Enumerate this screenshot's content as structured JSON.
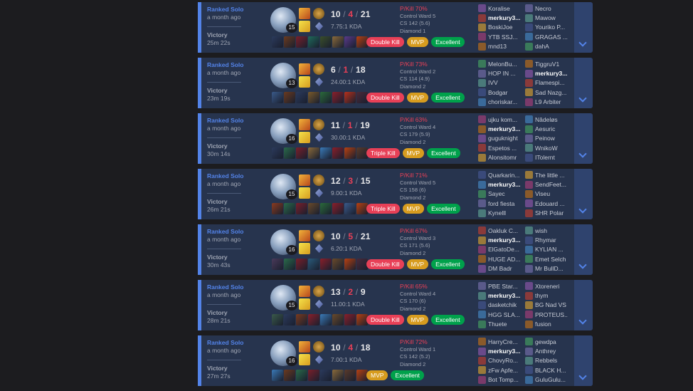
{
  "colors": {
    "win_accent": "#5383e8",
    "kill_red": "#e84057",
    "mvp": "#d79c1f",
    "excellent": "#00a14b"
  },
  "matches": [
    {
      "queue": "Ranked Solo",
      "ago": "a month ago",
      "result": "Victory",
      "duration": "25m 22s",
      "level": "15",
      "kills": "10",
      "deaths": "4",
      "assists": "21",
      "kda_ratio": "7.75:1 KDA",
      "badges": [
        "Double Kill",
        "MVP",
        "Excellent"
      ],
      "pkill": "P/Kill 70%",
      "control_ward": "Control Ward 5",
      "cs": "CS 142 (5.6)",
      "rank": "Diamond 1",
      "team1": [
        "Koralise",
        "merkury3...",
        "BoskiJoe",
        "YTB SSJ...",
        "mnd13"
      ],
      "team2": [
        "Necro",
        "Mawow",
        "Youriko P...",
        "GRAGAS ...",
        "dahA"
      ],
      "items": [
        "#2b3a5c",
        "#6b3a1e",
        "#7a1f2a",
        "#1f6a5a",
        "#3a4e2a",
        "#8a6a3a",
        "#5a3a8a",
        "#b84010"
      ]
    },
    {
      "queue": "Ranked Solo",
      "ago": "a month ago",
      "result": "Victory",
      "duration": "23m 19s",
      "level": "13",
      "kills": "6",
      "deaths": "1",
      "assists": "18",
      "kda_ratio": "24.00:1 KDA",
      "badges": [
        "Double Kill",
        "MVP",
        "Excellent"
      ],
      "pkill": "P/Kill 73%",
      "control_ward": "Control Ward 2",
      "cs": "CS 114 (4.9)",
      "rank": "Diamond 2",
      "team1": [
        "MelonBu...",
        "HOP IN ...",
        "IVV",
        "Bodgar",
        "choriskar..."
      ],
      "team2": [
        "TiggruV1",
        "merkury3...",
        "Flamespi...",
        "Sad Nazg...",
        "L9 Arbiter"
      ],
      "items": [
        "#3a5a8a",
        "#6b3a1e",
        "#2b3a5c",
        "#7a5a2a",
        "#2a6a3a",
        "#8a1f2a",
        "#b8301a",
        "#4a2a3a"
      ]
    },
    {
      "queue": "Ranked Solo",
      "ago": "a month ago",
      "result": "Victory",
      "duration": "30m 14s",
      "level": "16",
      "kills": "11",
      "deaths": "1",
      "assists": "19",
      "kda_ratio": "30.00:1 KDA",
      "badges": [
        "Triple Kill",
        "MVP",
        "Excellent"
      ],
      "pkill": "P/Kill 63%",
      "control_ward": "Control Ward 4",
      "cs": "CS 179 (5.9)",
      "rank": "Diamond 2",
      "team1": [
        "ujku kom...",
        "merkury3...",
        "guguknight",
        "Espetos ...",
        "Alonsitomr"
      ],
      "team2": [
        "Nâdeløs",
        "Aesuric",
        "Peinow",
        "WnikoW",
        "ITolernt"
      ],
      "items": [
        "#2b3a5c",
        "#2a6a4a",
        "#7a1f2a",
        "#8a6a3a",
        "#3a7ab8",
        "#8a1f2a",
        "#b84010",
        "#5a3a2a"
      ]
    },
    {
      "queue": "Ranked Solo",
      "ago": "a month ago",
      "result": "Victory",
      "duration": "26m 21s",
      "level": "15",
      "kills": "12",
      "deaths": "3",
      "assists": "15",
      "kda_ratio": "9.00:1 KDA",
      "badges": [
        "Triple Kill",
        "MVP",
        "Excellent"
      ],
      "pkill": "P/Kill 71%",
      "control_ward": "Control Ward 5",
      "cs": "CS 158 (6)",
      "rank": "Diamond 2",
      "team1": [
        "Quarkarin...",
        "merkury3...",
        "Sayec",
        "ford fiesta",
        "Kynelll"
      ],
      "team2": [
        "The little ...",
        "SendFeet...",
        "Viseu",
        "Edouard ...",
        "SHR Polar"
      ],
      "items": [
        "#8a3a1e",
        "#2a6a4a",
        "#7a1f2a",
        "#6a4a2a",
        "#2a6a3a",
        "#8a1f2a",
        "#3a5a8a",
        "#b84010"
      ]
    },
    {
      "queue": "Ranked Solo",
      "ago": "a month ago",
      "result": "Victory",
      "duration": "30m 43s",
      "level": "16",
      "kills": "10",
      "deaths": "5",
      "assists": "21",
      "kda_ratio": "6.20:1 KDA",
      "badges": [
        "Double Kill",
        "MVP",
        "Excellent"
      ],
      "pkill": "P/Kill 67%",
      "control_ward": "Control Ward 3",
      "cs": "CS 171 (5.6)",
      "rank": "Diamond 2",
      "team1": [
        "Oakluk C...",
        "merkury3...",
        "ElGatoDe...",
        "HUGE AD...",
        "DM Badr"
      ],
      "team2": [
        "wish",
        "Rhymar",
        "KYLIAN ...",
        "Emet Selch",
        "Mr BullD..."
      ],
      "items": [
        "#4a3a5a",
        "#2a6a4a",
        "#7a1f2a",
        "#2a5a7a",
        "#8a1f2a",
        "#6a4a2a",
        "#b84010",
        "#4a2a3a"
      ]
    },
    {
      "queue": "Ranked Solo",
      "ago": "a month ago",
      "result": "Victory",
      "duration": "28m 21s",
      "level": "15",
      "kills": "13",
      "deaths": "2",
      "assists": "9",
      "kda_ratio": "11.00:1 KDA",
      "badges": [
        "Double Kill",
        "MVP",
        "Excellent"
      ],
      "pkill": "P/Kill 65%",
      "control_ward": "Control Ward 4",
      "cs": "CS 170 (6)",
      "rank": "Diamond 2",
      "team1": [
        "PBE Star...",
        "merkury3...",
        "dasketchik",
        "HGG SLA...",
        "Thuete"
      ],
      "team2": [
        "Xtoreneri",
        "thym",
        "BG Nad VS",
        "PROTEUS...",
        "fusion"
      ],
      "items": [
        "#3a5a4a",
        "#2b3a5c",
        "#7a3a1e",
        "#8a1f2a",
        "#3a7ab8",
        "#6a4a2a",
        "#8a1f2a",
        "#b84010"
      ]
    },
    {
      "queue": "Ranked Solo",
      "ago": "a month ago",
      "result": "Victory",
      "duration": "27m 27s",
      "level": "16",
      "kills": "10",
      "deaths": "4",
      "assists": "18",
      "kda_ratio": "7.00:1 KDA",
      "badges": [
        "MVP",
        "Excellent"
      ],
      "pkill": "P/Kill 72%",
      "control_ward": "Control Ward 1",
      "cs": "CS 142 (5.2)",
      "rank": "Diamond 2",
      "team1": [
        "HarryCre...",
        "merkury3...",
        "ChovyRo...",
        "zFw Apfe...",
        "Bot Tomp..."
      ],
      "team2": [
        "gewdpa",
        "Anthrey",
        "Rebbels",
        "BLACK H...",
        "GuluGulu..."
      ],
      "items": [
        "#3a7ab8",
        "#6b3a1e",
        "#2a6a4a",
        "#7a1f2a",
        "#2b3a5c",
        "#8a6a3a",
        "#5a3a2a",
        "#b84010"
      ]
    }
  ]
}
